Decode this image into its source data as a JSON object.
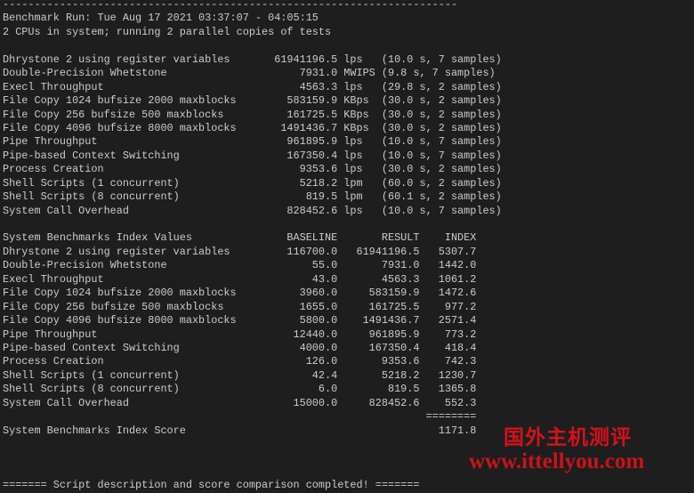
{
  "terminal": {
    "lines": [
      "------------------------------------------------------------------------",
      "Benchmark Run: Tue Aug 17 2021 03:37:07 - 04:05:15",
      "2 CPUs in system; running 2 parallel copies of tests",
      "",
      "Dhrystone 2 using register variables       61941196.5 lps   (10.0 s, 7 samples)",
      "Double-Precision Whetstone                     7931.0 MWIPS (9.8 s, 7 samples)",
      "Execl Throughput                               4563.3 lps   (29.8 s, 2 samples)",
      "File Copy 1024 bufsize 2000 maxblocks        583159.9 KBps  (30.0 s, 2 samples)",
      "File Copy 256 bufsize 500 maxblocks          161725.5 KBps  (30.0 s, 2 samples)",
      "File Copy 4096 bufsize 8000 maxblocks       1491436.7 KBps  (30.0 s, 2 samples)",
      "Pipe Throughput                              961895.9 lps   (10.0 s, 7 samples)",
      "Pipe-based Context Switching                 167350.4 lps   (10.0 s, 7 samples)",
      "Process Creation                               9353.6 lps   (30.0 s, 2 samples)",
      "Shell Scripts (1 concurrent)                   5218.2 lpm   (60.0 s, 2 samples)",
      "Shell Scripts (8 concurrent)                    819.5 lpm   (60.1 s, 2 samples)",
      "System Call Overhead                         828452.6 lps   (10.0 s, 7 samples)",
      "",
      "System Benchmarks Index Values               BASELINE       RESULT    INDEX",
      "Dhrystone 2 using register variables         116700.0   61941196.5   5307.7",
      "Double-Precision Whetstone                       55.0       7931.0   1442.0",
      "Execl Throughput                                 43.0       4563.3   1061.2",
      "File Copy 1024 bufsize 2000 maxblocks          3960.0     583159.9   1472.6",
      "File Copy 256 bufsize 500 maxblocks            1655.0     161725.5    977.2",
      "File Copy 4096 bufsize 8000 maxblocks          5800.0    1491436.7   2571.4",
      "Pipe Throughput                               12440.0     961895.9    773.2",
      "Pipe-based Context Switching                   4000.0     167350.4    418.4",
      "Process Creation                                126.0       9353.6    742.3",
      "Shell Scripts (1 concurrent)                     42.4       5218.2   1230.7",
      "Shell Scripts (8 concurrent)                      6.0        819.5   1365.8",
      "System Call Overhead                          15000.0     828452.6    552.3",
      "                                                                   ========",
      "System Benchmarks Index Score                                        1171.8",
      "",
      "",
      "",
      "======= Script description and score comparison completed! ======="
    ]
  },
  "watermark": {
    "title": "国外主机测评",
    "url": "www.ittellyou.com",
    "color": "#d4121c"
  }
}
